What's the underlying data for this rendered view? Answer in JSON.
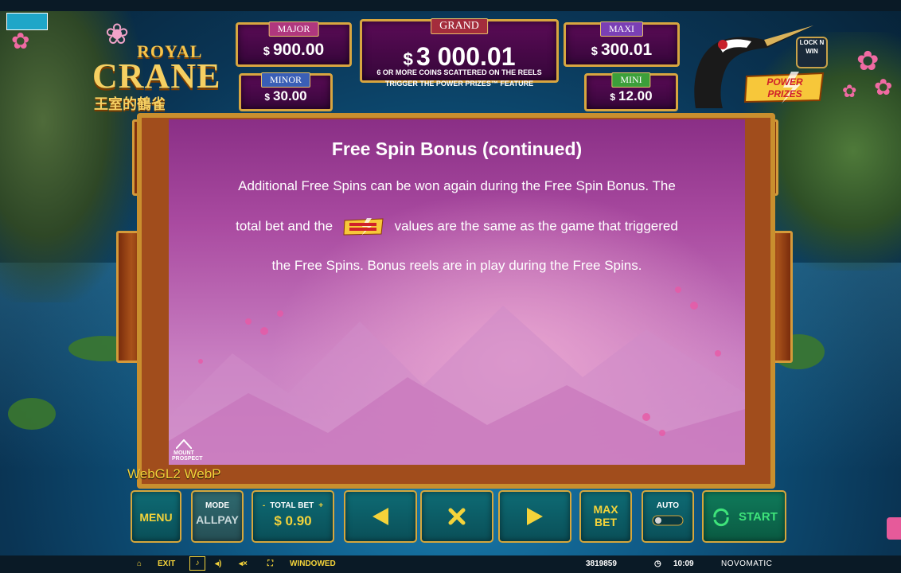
{
  "game": {
    "logo_top": "ROYAL",
    "logo_main": "CRANE",
    "logo_cn": "王室的鶴雀"
  },
  "jackpots": {
    "major": {
      "label": "MAJOR",
      "currency": "$",
      "amount": "900.00"
    },
    "grand": {
      "label": "GRAND",
      "currency": "$",
      "amount": "3 000.01"
    },
    "maxi": {
      "label": "MAXI",
      "currency": "$",
      "amount": "300.01"
    },
    "minor": {
      "label": "MINOR",
      "currency": "$",
      "amount": "30.00"
    },
    "mini": {
      "label": "MINI",
      "currency": "$",
      "amount": "12.00"
    },
    "note_line1": "6 OR MORE COINS SCATTERED ON THE REELS",
    "note_line2": "TRIGGER THE POWER PRIZES™ FEATURE"
  },
  "badges": {
    "lock_n_win": "LOCK N WIN",
    "power_prizes": "POWER PRIZES"
  },
  "dialog": {
    "title": "Free Spin Bonus (continued)",
    "line1": "Additional Free Spins can be won again during the Free Spin Bonus. The",
    "line2_a": "total bet and the",
    "line2_b": "values are the same as the game that triggered",
    "line3": "the Free Spins. Bonus reels are in play during the Free Spins.",
    "publisher_mark": "MOUNT PROSPECT"
  },
  "render_info": "WebGL2  WebP",
  "controls": {
    "menu": "MENU",
    "mode_label": "MODE",
    "mode_value": "ALLPAY",
    "total_bet_label": "TOTAL BET",
    "total_bet_minus": "-",
    "total_bet_plus": "+",
    "total_bet_value": "$ 0.90",
    "max_bet_1": "MAX",
    "max_bet_2": "BET",
    "auto": "AUTO",
    "start": "START"
  },
  "status": {
    "exit": "EXIT",
    "windowed": "WINDOWED",
    "session_id": "3819859",
    "time": "10:09",
    "brand": "NOVOMATIC"
  },
  "colors": {
    "frame_gold": "#d6a73c",
    "button_teal": "#0e6b74",
    "accent_yellow": "#f4d33a",
    "dialog_magenta": "#a94aa0"
  }
}
